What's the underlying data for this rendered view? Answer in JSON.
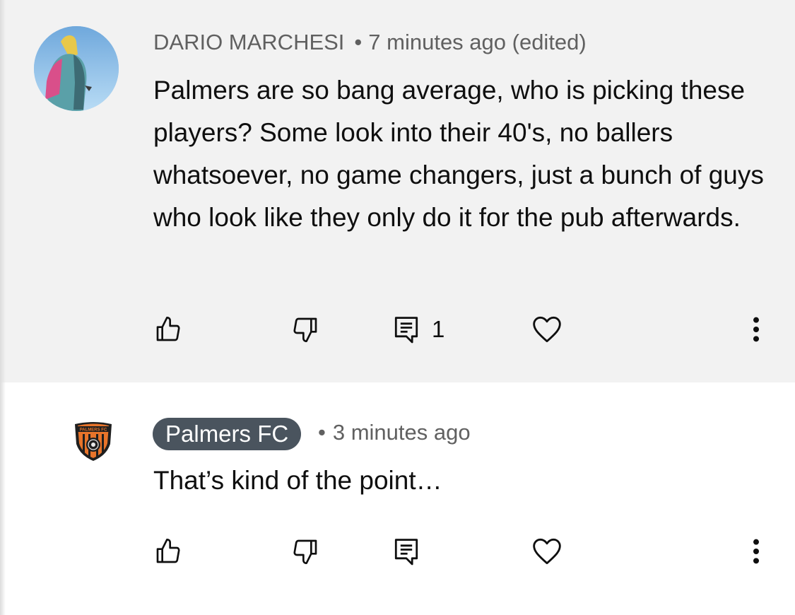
{
  "comments": [
    {
      "author": "DARIO MARCHESI",
      "separator": "•",
      "time": "7 minutes ago (edited)",
      "text": "Palmers are so bang average, who is picking these players? Some look into their 40's, no ballers whatsoever, no game changers, just a bunch of guys who look like they only do it for the pub afterwards.",
      "reply_count": "1",
      "icons": [
        "thumbs-up-icon",
        "thumbs-down-icon",
        "reply-icon",
        "heart-icon",
        "more-vert-icon"
      ]
    },
    {
      "author": "Palmers FC",
      "separator": "•",
      "time": "3 minutes ago",
      "text": "That’s kind of the point…",
      "crest_text": "PALMERS FC",
      "icons": [
        "thumbs-up-icon",
        "thumbs-down-icon",
        "reply-icon",
        "heart-icon",
        "more-vert-icon"
      ]
    }
  ],
  "colors": {
    "highlight_bg": "#f2f2f2",
    "meta_text": "#606060",
    "badge_bg": "#4a545e",
    "crest_orange": "#e8742a"
  }
}
